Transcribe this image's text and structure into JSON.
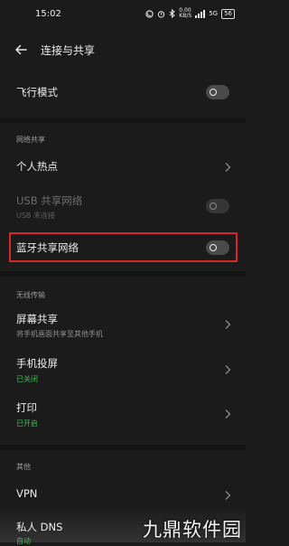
{
  "status_bar": {
    "time": "15:02",
    "speed_value": "0.00",
    "speed_unit": "KB/S",
    "network": "5G",
    "battery": "56"
  },
  "header": {
    "title": "连接与共享"
  },
  "items": {
    "airplane_mode": {
      "label": "飞行模式",
      "state": "off"
    },
    "network_sharing_section": "网络共享",
    "hotspot": {
      "label": "个人热点"
    },
    "usb_tethering": {
      "label": "USB 共享网络",
      "sub": "USB 未连接",
      "state": "off-disabled"
    },
    "bluetooth_tethering": {
      "label": "蓝牙共享网络",
      "state": "off"
    },
    "wireless_section": "无线传输",
    "screen_share": {
      "label": "屏幕共享",
      "sub": "将手机画面共享至其他手机"
    },
    "screen_cast": {
      "label": "手机投屏",
      "sub": "已关闭"
    },
    "print": {
      "label": "打印",
      "sub": "已开启"
    },
    "other_section": "其他",
    "vpn": {
      "label": "VPN"
    },
    "private_dns": {
      "label": "私人 DNS",
      "sub": "自动"
    }
  },
  "watermark": "九鼎软件园",
  "colors": {
    "background": "#1b1b1b",
    "accent_green": "#37c24f",
    "highlight_red": "#d6272b",
    "disabled_text": "#6d6d6d"
  }
}
